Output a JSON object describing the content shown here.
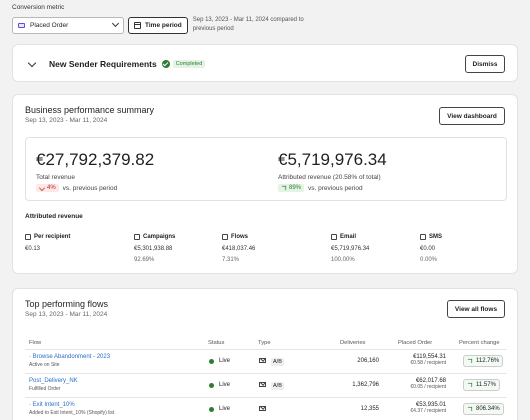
{
  "header": {
    "metric_label": "Conversion metric",
    "metric_value": "Placed Order",
    "time_button": "Time period",
    "date_note": "Sep 13, 2023 - Mar 11, 2024 compared to previous period"
  },
  "banner": {
    "title": "New Sender Requirements",
    "status": "Completed",
    "dismiss": "Dismiss"
  },
  "summary": {
    "title": "Business performance summary",
    "range": "Sep 13, 2023 - Mar 11, 2024",
    "view_dashboard": "View dashboard",
    "total_revenue": {
      "value": "€27,792,379.82",
      "label": "Total revenue",
      "change": "4%",
      "note": "vs. previous period",
      "direction": "down"
    },
    "attributed_revenue": {
      "value": "€5,719,976.34",
      "label": "Attributed revenue (20.58% of total)",
      "change": "89%",
      "note": "vs. previous period",
      "direction": "up"
    },
    "attributed_title": "Attributed revenue",
    "metrics": [
      {
        "name": "Per recipient",
        "value": "€0.13",
        "pct": "",
        "icon": "person-icon"
      },
      {
        "name": "Campaigns",
        "value": "€5,301,938.88",
        "pct": "92.69%",
        "icon": "campaign-icon"
      },
      {
        "name": "Flows",
        "value": "€418,037.46",
        "pct": "7.31%",
        "icon": "flow-icon"
      },
      {
        "name": "Email",
        "value": "€5,719,976.34",
        "pct": "100.00%",
        "icon": "mail-icon"
      },
      {
        "name": "SMS",
        "value": "€0.00",
        "pct": "0.00%",
        "icon": "sms-icon"
      }
    ]
  },
  "flows": {
    "title": "Top performing flows",
    "range": "Sep 13, 2023 - Mar 11, 2024",
    "view_all": "View all flows",
    "columns": [
      "Flow",
      "Status",
      "Type",
      "Deliveries",
      "Placed Order",
      "Percent change"
    ],
    "rows": [
      {
        "name": "· Browse Abandonment - 2023",
        "sub": "Active on Site",
        "status": "Live",
        "ab": "A/B",
        "deliveries": "206,160",
        "order": "€119,554.31",
        "order_sub": "€0.58 / recipient",
        "change": "112.76%"
      },
      {
        "name": "Post_Delivery_NK",
        "sub": "Fulfilled Order",
        "status": "Live",
        "ab": "A/B",
        "deliveries": "1,362,796",
        "order": "€62,017.68",
        "order_sub": "€0.05 / recipient",
        "change": "11.57%"
      },
      {
        "name": "· Exit Intent_10%",
        "sub": "Added to Exit Intent_10% (Shopify) list",
        "status": "Live",
        "ab": "",
        "deliveries": "12,355",
        "order": "€53,935.01",
        "order_sub": "€4.37 / recipient",
        "change": "806.34%"
      }
    ]
  }
}
